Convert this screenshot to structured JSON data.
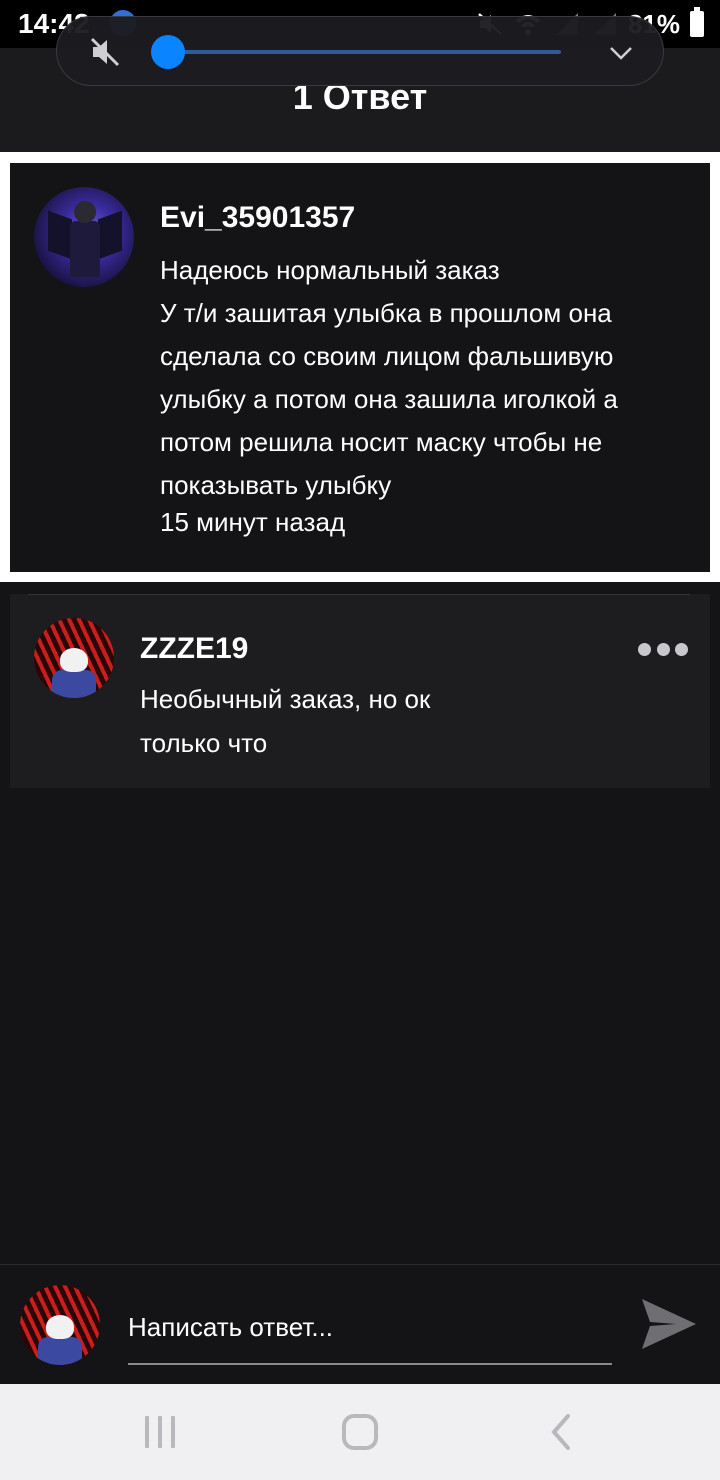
{
  "status_bar": {
    "time": "14:42",
    "battery": "81%"
  },
  "header": {
    "title": "1 Ответ"
  },
  "volume_overlay": {
    "level": 0.0,
    "muted": true,
    "accent": "#0a84ff"
  },
  "comment": {
    "author": "Evi_35901357",
    "lines": [
      "Надеюсь нормальный заказ",
      "У т/и зашитая улыбка в прошлом она",
      "сделала со своим лицом фальшивую",
      "улыбку а потом она зашила иголкой а",
      "потом решила носит маску чтобы не",
      "показывать улыбку"
    ],
    "time": "15 минут назад"
  },
  "reply": {
    "author": "ZZZE19",
    "text": "Необычный заказ, но ок",
    "time": "только что"
  },
  "composer": {
    "placeholder": "Написать ответ..."
  },
  "icons": {
    "mute": "speaker-muted-icon",
    "expand": "chevron-down-icon",
    "more": "more-dots-icon",
    "send": "send-icon",
    "recent": "recent-apps-icon",
    "home": "home-icon",
    "back": "back-icon"
  },
  "colors": {
    "background": "#141316",
    "reply_background": "#1d1d20",
    "nav_background": "#f0f0f2"
  }
}
